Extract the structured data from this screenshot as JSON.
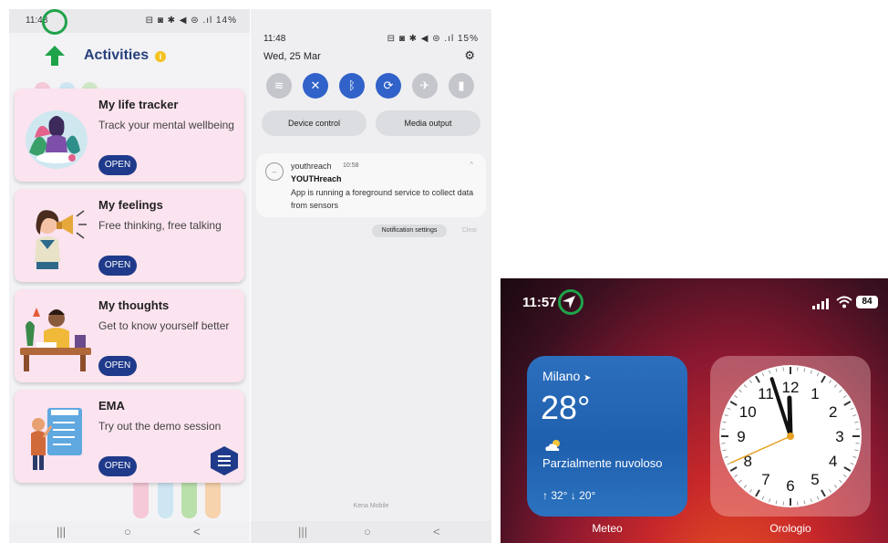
{
  "panel1": {
    "status_time": "11:48",
    "status_icons": "⊟ ◙ ✱ ◀︎ ⊜ .ıl",
    "status_battery": "14%",
    "header": {
      "title": "Activities",
      "info": "i"
    },
    "cards": [
      {
        "title": "My life tracker",
        "subtitle": "Track your mental wellbeing",
        "button": "OPEN",
        "illustration": "meditating-woman-icon"
      },
      {
        "title": "My feelings",
        "subtitle": "Free thinking, free talking",
        "button": "OPEN",
        "illustration": "megaphone-girl-icon"
      },
      {
        "title": "My thoughts",
        "subtitle": "Get to know yourself better",
        "button": "OPEN",
        "illustration": "writing-man-icon"
      },
      {
        "title": "EMA",
        "subtitle": "Try out the demo session",
        "button": "OPEN",
        "illustration": "survey-person-icon"
      }
    ],
    "navbar": [
      "|||",
      "○",
      "<"
    ],
    "colors": {
      "card": "#fbe3ef",
      "button": "#1f3a8a",
      "title": "#27407a",
      "arrow": "#1fa34a"
    }
  },
  "panel2": {
    "time": "11:48",
    "status_icons": "⊟ ◙ ✱ ◀︎ ⊜ .ıl",
    "status_battery": "15%",
    "date": "Wed, 25 Mar",
    "quick_settings": [
      {
        "icon": "wifi-icon",
        "glyph": "≋",
        "on": false
      },
      {
        "icon": "mute-icon",
        "glyph": "✕",
        "on": true
      },
      {
        "icon": "bluetooth-icon",
        "glyph": "ᛒ",
        "on": true
      },
      {
        "icon": "autorotate-icon",
        "glyph": "⟳",
        "on": true
      },
      {
        "icon": "airplane-icon",
        "glyph": "✈",
        "on": false
      },
      {
        "icon": "flashlight-icon",
        "glyph": "▮",
        "on": false
      }
    ],
    "pills": [
      "Device control",
      "Media output"
    ],
    "notification": {
      "app": "youthreach",
      "time": "10:58",
      "title": "YOUTHreach",
      "body": "App is running a foreground service to collect data from sensors"
    },
    "notification_settings": "Notification settings",
    "clear": "Clear",
    "carrier": "Kena Mobile",
    "navbar": [
      "|||",
      "○",
      "<"
    ]
  },
  "panel3": {
    "time": "11:57",
    "battery": "84",
    "weather": {
      "city": "Milano",
      "temp": "28°",
      "condition": "Parzialmente nuvoloso",
      "range": "↑ 32° ↓ 20°",
      "label": "Meteo"
    },
    "clock": {
      "label": "Orologio",
      "numbers": [
        "12",
        "1",
        "2",
        "3",
        "4",
        "5",
        "6",
        "7",
        "8",
        "9",
        "10",
        "11"
      ],
      "hour": 11,
      "minute": 57,
      "second": 41
    }
  }
}
